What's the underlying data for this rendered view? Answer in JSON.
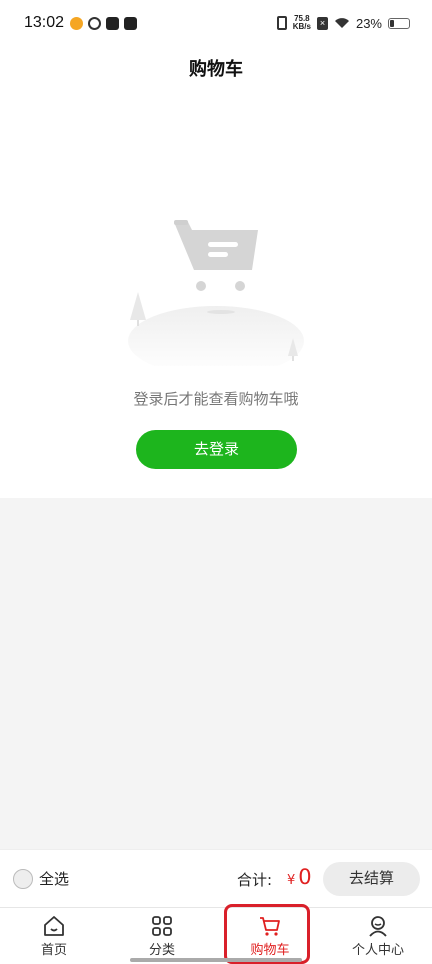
{
  "status_bar": {
    "time": "13:02",
    "net_speed_value": "75.8",
    "net_speed_unit": "KB/s",
    "battery": "23%"
  },
  "header": {
    "title": "购物车"
  },
  "empty_state": {
    "message": "登录后才能查看购物车哦",
    "login_button": "去登录"
  },
  "checkout_bar": {
    "select_all": "全选",
    "total_label": "合计:",
    "currency": "¥",
    "total_amount": "0",
    "checkout_button": "去结算"
  },
  "tabs": [
    {
      "label": "首页",
      "icon": "home-icon",
      "active": false
    },
    {
      "label": "分类",
      "icon": "grid-icon",
      "active": false
    },
    {
      "label": "购物车",
      "icon": "cart-icon",
      "active": true
    },
    {
      "label": "个人中心",
      "icon": "user-icon",
      "active": false
    }
  ],
  "colors": {
    "accent_green": "#1db51d",
    "price_red": "#e02020",
    "active_tab_red": "#e02020",
    "highlight_box": "#d9202a"
  }
}
